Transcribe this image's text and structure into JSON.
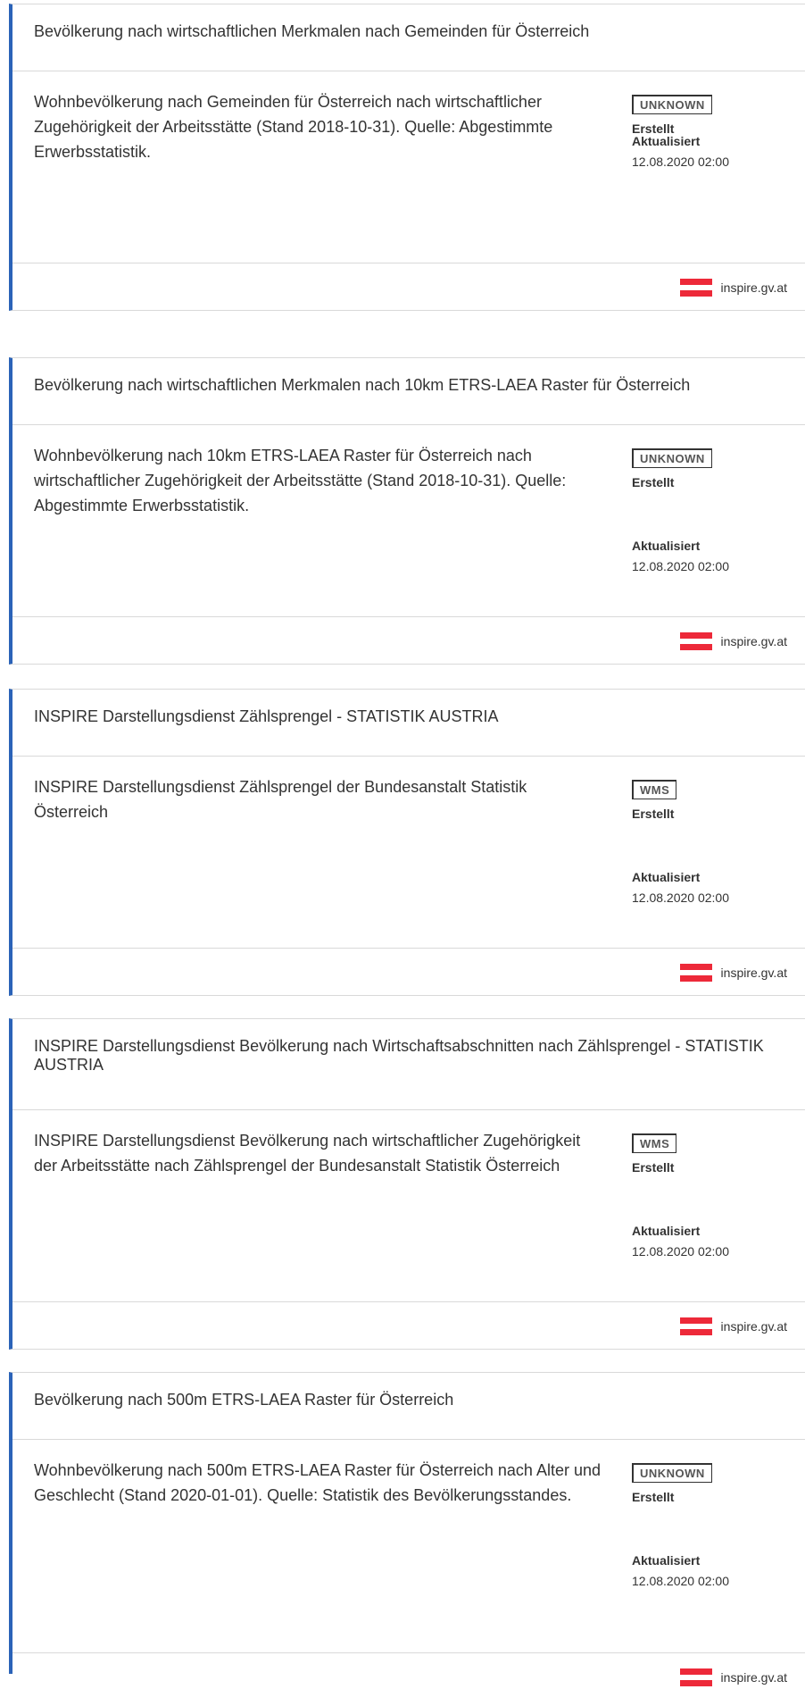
{
  "results": [
    {
      "title": "Bevölkerung nach wirtschaftlichen Merkmalen nach Gemeinden für Österreich",
      "description": "Wohnbevölkerung nach Gemeinden für Österreich nach wirtschaftlicher Zugehörigkeit der Arbeitsstätte (Stand 2018-10-31). Quelle: Abgestimmte Erwerbsstatistik.",
      "badge": "UNKNOWN",
      "created_label": "Erstellt",
      "updated_label": "Aktualisiert",
      "updated_value": "12.08.2020 02:00",
      "source": "inspire.gv.at"
    },
    {
      "title": "Bevölkerung nach wirtschaftlichen Merkmalen nach 10km ETRS-LAEA Raster für Österreich",
      "description": "Wohnbevölkerung nach 10km ETRS-LAEA Raster für Österreich nach wirtschaftlicher Zugehörigkeit der Arbeitsstätte (Stand 2018-10-31). Quelle: Abgestimmte Erwerbsstatistik.",
      "badge": "UNKNOWN",
      "created_label": "Erstellt",
      "updated_label": "Aktualisiert",
      "updated_value": "12.08.2020 02:00",
      "source": "inspire.gv.at"
    },
    {
      "title": "INSPIRE Darstellungsdienst Zählsprengel - STATISTIK AUSTRIA",
      "description": "INSPIRE Darstellungsdienst Zählsprengel der Bundesanstalt Statistik Österreich",
      "badge": "WMS",
      "created_label": "Erstellt",
      "updated_label": "Aktualisiert",
      "updated_value": "12.08.2020 02:00",
      "source": "inspire.gv.at"
    },
    {
      "title": "INSPIRE Darstellungsdienst Bevölkerung nach Wirtschaftsabschnitten nach Zählsprengel - STATISTIK AUSTRIA",
      "description": "INSPIRE Darstellungsdienst Bevölkerung nach wirtschaftlicher Zugehörigkeit der Arbeitsstätte nach Zählsprengel der Bundesanstalt Statistik Österreich",
      "badge": "WMS",
      "created_label": "Erstellt",
      "updated_label": "Aktualisiert",
      "updated_value": "12.08.2020 02:00",
      "source": "inspire.gv.at"
    },
    {
      "title": "Bevölkerung nach 500m ETRS-LAEA Raster für Österreich",
      "description": "Wohnbevölkerung nach 500m ETRS-LAEA Raster für Österreich nach Alter und Geschlecht (Stand 2020-01-01). Quelle: Statistik des Bevölkerungsstandes.",
      "badge": "UNKNOWN",
      "created_label": "Erstellt",
      "updated_label": "Aktualisiert",
      "updated_value": "12.08.2020 02:00",
      "source": "inspire.gv.at"
    }
  ],
  "flag_colors": {
    "red": "#ed2939",
    "white": "#ffffff"
  },
  "accent_color": "#2b63b8"
}
